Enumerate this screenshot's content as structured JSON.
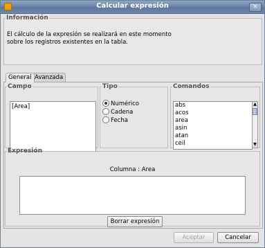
{
  "window": {
    "title": "Calcular expresión"
  },
  "info": {
    "legend": "Información",
    "line1": "El cálculo de la expresión se realizará en este momento",
    "line2": "sobre los registros existentes en la tabla."
  },
  "tabs": [
    {
      "label": "General",
      "active": true
    },
    {
      "label": "Avanzada",
      "active": false
    }
  ],
  "campo": {
    "legend": "Campo",
    "items": [
      "[Area]"
    ]
  },
  "tipo": {
    "legend": "Tipo",
    "options": [
      {
        "label": "Numérico",
        "checked": true
      },
      {
        "label": "Cadena",
        "checked": false
      },
      {
        "label": "Fecha",
        "checked": false
      }
    ]
  },
  "comandos": {
    "legend": "Comandos",
    "items": [
      "abs",
      "acos",
      "area",
      "asin",
      "atan",
      "ceil"
    ]
  },
  "expresion": {
    "legend": "Expresión",
    "columna": "Columna : Area",
    "value": ""
  },
  "buttons": {
    "borrar": "Borrar expresión",
    "aceptar": "Aceptar",
    "cancelar": "Cancelar"
  },
  "icons": {
    "app": "app-icon",
    "close": "close-icon",
    "scroll_up": "arrow-up-icon",
    "scroll_down": "arrow-down-icon"
  }
}
